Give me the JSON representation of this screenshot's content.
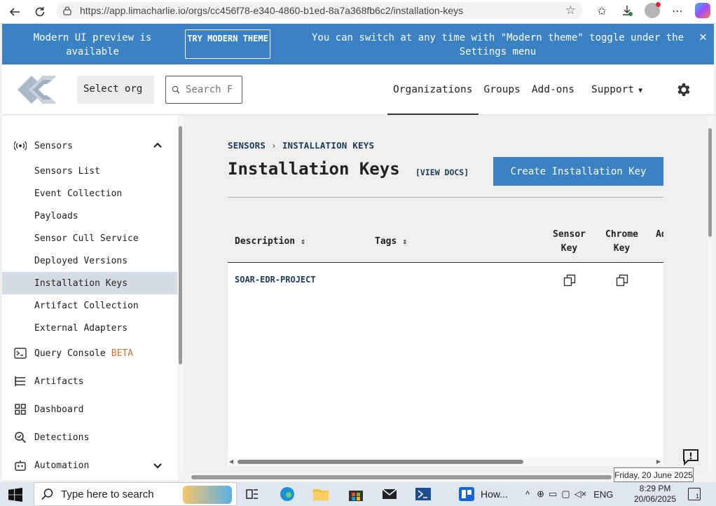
{
  "browser": {
    "url": "https://app.limacharlie.io/orgs/cc456f78-e340-4860-b1ed-8a7a368fb6c2/installation-keys"
  },
  "banner": {
    "left_text": "Modern UI preview is available",
    "try_button": "TRY MODERN THEME",
    "right_text": "You can switch at any time with \"Modern theme\" toggle under the Settings menu",
    "close": "✕"
  },
  "header": {
    "org_select": "Select org",
    "search_placeholder": "Search F",
    "nav": [
      "Organizations",
      "Groups",
      "Add-ons",
      "Support"
    ]
  },
  "sidebar": {
    "sensors_label": "Sensors",
    "sub_items": [
      "Sensors List",
      "Event Collection",
      "Payloads",
      "Sensor Cull Service",
      "Deployed Versions",
      "Installation Keys",
      "Artifact Collection",
      "External Adapters"
    ],
    "active_sub": "Installation Keys",
    "query_console": "Query Console",
    "beta": "BETA",
    "artifacts": "Artifacts",
    "dashboard": "Dashboard",
    "detections": "Detections",
    "automation": "Automation"
  },
  "main": {
    "breadcrumb_root": "SENSORS",
    "breadcrumb_sep": "›",
    "breadcrumb_current": "INSTALLATION KEYS",
    "title": "Installation Keys",
    "docs_link": "[VIEW DOCS]",
    "create_button": "Create Installation Key",
    "columns": {
      "description": "Description",
      "tags": "Tags",
      "sensor_key_line1": "Sensor",
      "sensor_key_line2": "Key",
      "chrome_key_line1": "Chrome",
      "chrome_key_line2": "Key",
      "truncated": "Ad"
    },
    "rows": [
      {
        "description": "SOAR-EDR-PROJECT",
        "tags": ""
      }
    ]
  },
  "tooltip": "Friday, 20 June 2025",
  "taskbar": {
    "search_placeholder": "Type here to search",
    "app_label": "How...",
    "lang": "ENG",
    "time": "8:29 PM",
    "date": "20/06/2025",
    "notif_count": "1"
  },
  "colors": {
    "accent": "#3b82c4",
    "link": "#1f3b5a",
    "beta": "#c8742e"
  }
}
